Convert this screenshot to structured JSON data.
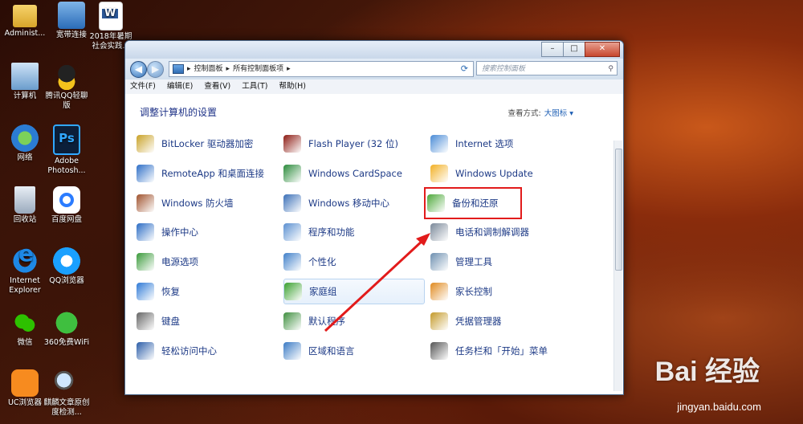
{
  "desktop": {
    "icons": [
      {
        "label": "Administ...",
        "x": 0
      },
      {
        "label": "宽带连接"
      },
      {
        "label": "2018年暑期社会实践..."
      },
      {
        "label": "计算机"
      },
      {
        "label": "腾讯QQ轻聊版"
      },
      {
        "label": "网络"
      },
      {
        "label": "Adobe Photosh..."
      },
      {
        "label": "回收站"
      },
      {
        "label": "百度网盘"
      },
      {
        "label": "Internet Explorer"
      },
      {
        "label": "QQ浏览器"
      },
      {
        "label": "微信"
      },
      {
        "label": "360免费WiFi"
      },
      {
        "label": "UC浏览器"
      },
      {
        "label": "麒麟文章原创度检测..."
      }
    ]
  },
  "window": {
    "caption_buttons": [
      "–",
      "□",
      "✕"
    ],
    "address": {
      "segments": [
        "控制面板",
        "所有控制面板项"
      ],
      "separator": "▸"
    },
    "search_placeholder": "搜索控制面板",
    "menu": [
      "文件(F)",
      "编辑(E)",
      "查看(V)",
      "工具(T)",
      "帮助(H)"
    ],
    "heading": "调整计算机的设置",
    "view_by_label": "查看方式:",
    "view_by_value": "大图标 ▾",
    "items": [
      [
        "BitLocker 驱动器加密",
        "Flash Player (32 位)",
        "Internet 选项"
      ],
      [
        "RemoteApp 和桌面连接",
        "Windows CardSpace",
        "Windows Update"
      ],
      [
        "Windows 防火墙",
        "Windows 移动中心",
        "备份和还原"
      ],
      [
        "操作中心",
        "程序和功能",
        "电话和调制解调器"
      ],
      [
        "电源选项",
        "个性化",
        "管理工具"
      ],
      [
        "恢复",
        "家庭组",
        "家长控制"
      ],
      [
        "键盘",
        "默认程序",
        "凭据管理器"
      ],
      [
        "轻松访问中心",
        "区域和语言",
        "任务栏和「开始」菜单"
      ]
    ],
    "highlighted_item": "备份和还原",
    "hovered_item": "家庭组"
  },
  "watermark": {
    "logo": "Bai 经验",
    "url": "jingyan.baidu.com"
  },
  "colors": {
    "link": "#1d3a86",
    "heading": "#1e3287",
    "highlight": "#e21b1b"
  }
}
